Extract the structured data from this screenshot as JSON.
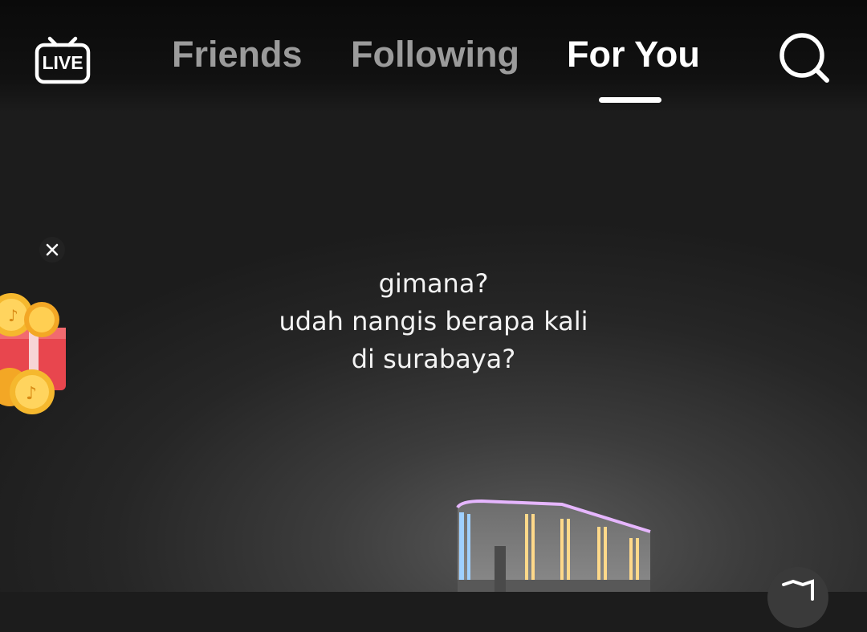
{
  "header": {
    "live_label": "LIVE",
    "tabs": [
      {
        "label": "Friends",
        "active": false
      },
      {
        "label": "Following",
        "active": false
      },
      {
        "label": "For You",
        "active": true
      }
    ],
    "search_icon": "search-icon"
  },
  "video": {
    "caption_lines": [
      "gimana?",
      "udah nangis berapa kali",
      "di surabaya?"
    ]
  },
  "promo": {
    "icon": "coin-gift-icon",
    "close_icon": "close-icon"
  },
  "colors": {
    "active_tab": "#ffffff",
    "inactive_tab": "#9b9b9b",
    "coin_gold": "#f5b82e",
    "gift_red": "#e8464e"
  }
}
